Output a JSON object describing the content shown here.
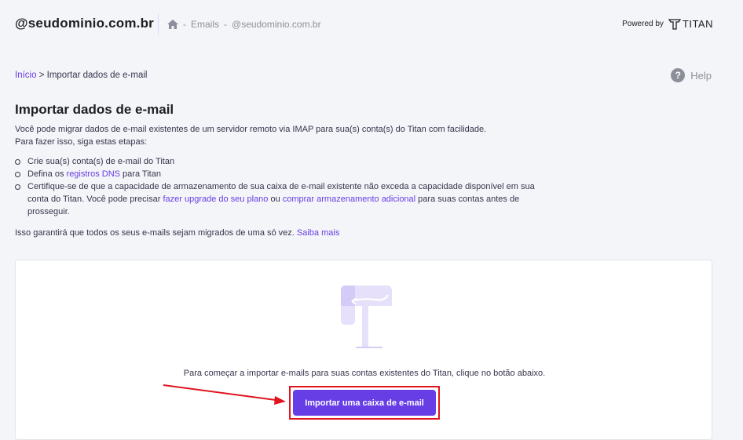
{
  "header": {
    "domain": "@seudominio.com.br",
    "breadcrumb": {
      "section": "Emails",
      "separator": "-",
      "account": "@seudominio.com.br"
    },
    "powered_by": "Powered by",
    "brand": "TITAN"
  },
  "breadcrumb": {
    "home": "Início",
    "separator": ">",
    "current": "Importar dados de e-mail"
  },
  "help": {
    "label": "Help",
    "icon": "?"
  },
  "page": {
    "title": "Importar dados de e-mail",
    "intro_line1": "Você pode migrar dados de e-mail existentes de um servidor remoto via IMAP para sua(s) conta(s) do Titan com facilidade.",
    "intro_line2": "Para fazer isso, siga estas etapas:",
    "step1": "Crie sua(s) conta(s) de e-mail do Titan",
    "step2_prefix": "Defina os ",
    "step2_link": "registros DNS",
    "step2_suffix": " para Titan",
    "step3_part1": "Certifique-se de que a capacidade de armazenamento de sua caixa de e-mail existente não exceda a capacidade disponível em sua conta do Titan. Você pode precisar ",
    "step3_link1": "fazer upgrade do seu plano",
    "step3_mid": " ou ",
    "step3_link2": "comprar armazenamento adicional",
    "step3_end": " para suas contas antes de prosseguir.",
    "outro_text": "Isso garantirá que todos os seus e-mails sejam migrados de uma só vez. ",
    "outro_link": "Saiba mais"
  },
  "card": {
    "text": "Para começar a importar e-mails para suas contas existentes do Titan, clique no botão abaixo.",
    "button": "Importar uma caixa de e-mail"
  },
  "colors": {
    "accent": "#673de6",
    "highlight": "#e0141e",
    "background": "#f4f5f8",
    "illustration": "#e6e0fb"
  }
}
